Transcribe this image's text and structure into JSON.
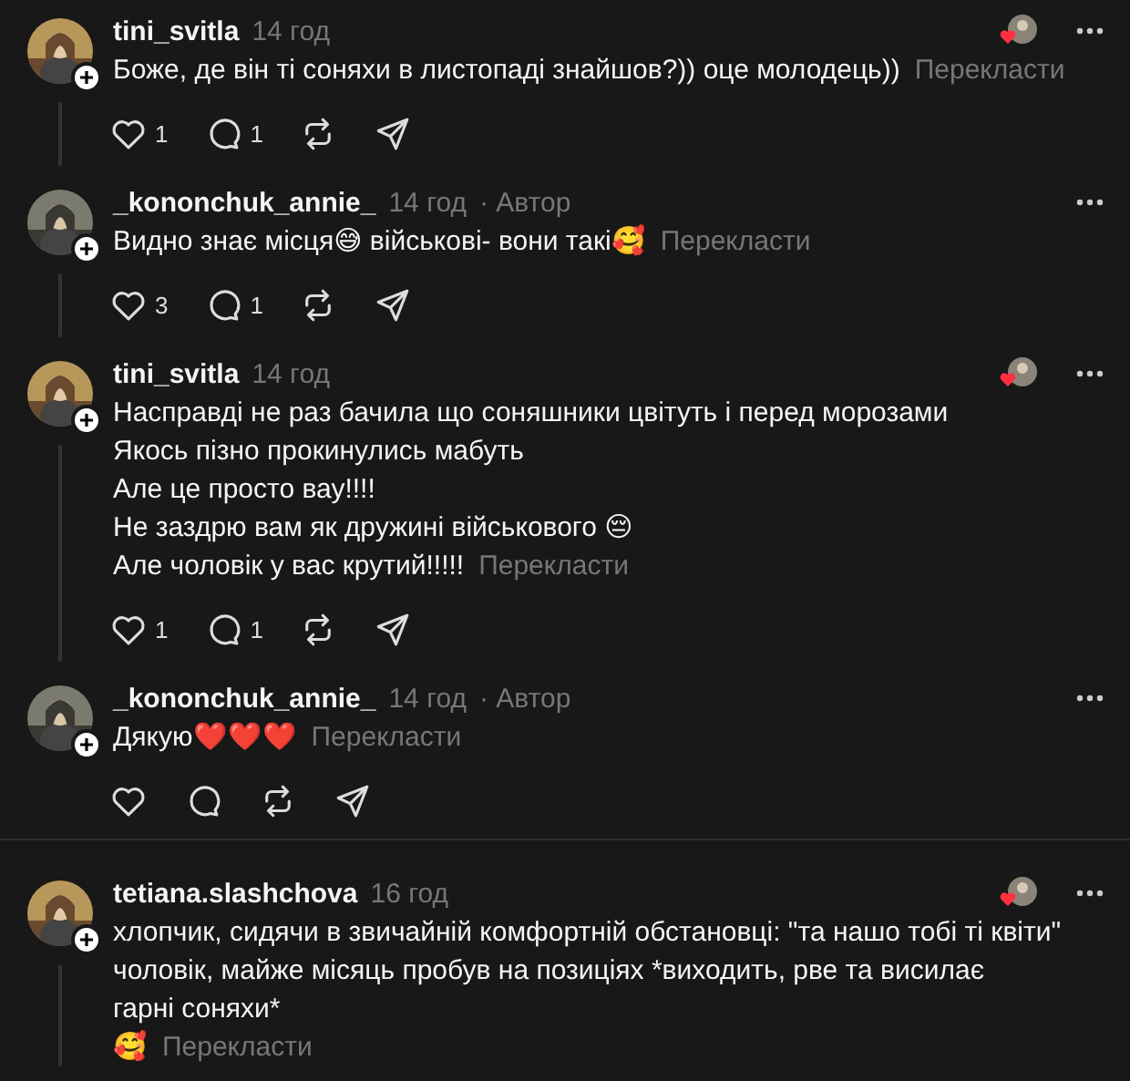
{
  "threads": [
    {
      "comments": [
        {
          "username": "tini_svitla",
          "time": "14 год",
          "lines": [
            "Боже, де він ті соняхи в листопаді знайшов?)) оце молодець))"
          ],
          "translate": "Перекласти",
          "liked_by_author": true,
          "thread_line": true,
          "has_actions": true,
          "likes": "1",
          "replies": "1"
        },
        {
          "username": "_kononchuk_annie_",
          "time": "14 год",
          "author_badge": "· Автор",
          "lines": [
            "Видно знає місця😅 військові- вони такі🥰"
          ],
          "translate": "Перекласти",
          "liked_by_author": false,
          "thread_line": true,
          "has_actions": true,
          "likes": "3",
          "replies": "1"
        },
        {
          "username": "tini_svitla",
          "time": "14 год",
          "lines": [
            "Насправді не раз бачила що соняшники цвітуть і перед морозами",
            "Якось пізно прокинулись мабуть",
            "Але це просто вау!!!!",
            "Не заздрю вам як дружині військового 😔",
            "Але чоловік у вас крутий!!!!!"
          ],
          "translate": "Перекласти",
          "liked_by_author": true,
          "thread_line": true,
          "has_actions": true,
          "likes": "1",
          "replies": "1"
        },
        {
          "username": "_kononchuk_annie_",
          "time": "14 год",
          "author_badge": "· Автор",
          "lines": [
            "Дякую❤️❤️❤️"
          ],
          "translate": "Перекласти",
          "liked_by_author": false,
          "thread_line": false,
          "has_actions": true
        }
      ]
    },
    {
      "comments": [
        {
          "username": "tetiana.slashchova",
          "time": "16 год",
          "lines": [
            "хлопчик, сидячи в звичайній комфортній обстановці: \"та нашо тобі ті квіти\"",
            "чоловік, майже місяць пробув на позиціях *виходить, рве та висилає",
            "гарні соняхи*",
            "🥰"
          ],
          "translate": "Перекласти",
          "liked_by_author": true,
          "thread_line": true,
          "has_actions": false
        }
      ]
    }
  ]
}
